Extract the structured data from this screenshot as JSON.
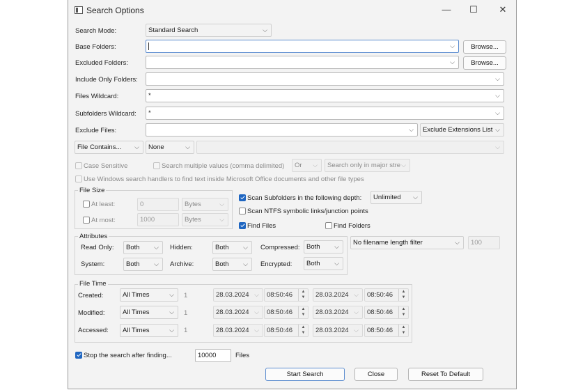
{
  "window": {
    "title": "Search Options",
    "min": "—",
    "max": "☐",
    "close": "✕"
  },
  "search_mode": {
    "label": "Search Mode:",
    "value": "Standard Search"
  },
  "base_folders": {
    "label": "Base Folders:",
    "value": "",
    "browse": "Browse..."
  },
  "excluded_folders": {
    "label": "Excluded Folders:",
    "value": "",
    "browse": "Browse..."
  },
  "include_only": {
    "label": "Include Only Folders:",
    "value": ""
  },
  "files_wildcard": {
    "label": "Files Wildcard:",
    "value": "*"
  },
  "subfolders_wildcard": {
    "label": "Subfolders Wildcard:",
    "value": "*"
  },
  "exclude_files": {
    "label": "Exclude Files:",
    "value": "",
    "ext_list": "Exclude Extensions List"
  },
  "contains": {
    "mode": "File Contains...",
    "type": "None",
    "value": ""
  },
  "options": {
    "case_sensitive": "Case Sensitive",
    "search_multiple": "Search multiple values (comma delimited)",
    "or": "Or",
    "major_streams": "Search only in major stre",
    "windows_handlers": "Use Windows search handlers to find text inside Microsoft Office documents and other file types"
  },
  "file_size": {
    "title": "File Size",
    "at_least": "At least:",
    "at_least_value": "0",
    "at_least_unit": "Bytes",
    "at_most": "At most:",
    "at_most_value": "1000",
    "at_most_unit": "Bytes"
  },
  "scan": {
    "subfolders": "Scan Subfolders in the following depth:",
    "depth": "Unlimited",
    "ntfs": "Scan NTFS symbolic links/junction points",
    "find_files": "Find Files",
    "find_folders": "Find Folders"
  },
  "attributes": {
    "title": "Attributes",
    "read_only": "Read Only:",
    "read_only_value": "Both",
    "hidden": "Hidden:",
    "hidden_value": "Both",
    "compressed": "Compressed:",
    "compressed_value": "Both",
    "system": "System:",
    "system_value": "Both",
    "archive": "Archive:",
    "archive_value": "Both",
    "encrypted": "Encrypted:",
    "encrypted_value": "Both"
  },
  "name_length": {
    "value": "No filename length filter",
    "number": "100"
  },
  "file_time": {
    "title": "File Time",
    "rows": [
      {
        "label": "Created:",
        "mode": "All Times",
        "num": "1",
        "date1": "28.03.2024",
        "time1": "08:50:46",
        "date2": "28.03.2024",
        "time2": "08:50:46"
      },
      {
        "label": "Modified:",
        "mode": "All Times",
        "num": "1",
        "date1": "28.03.2024",
        "time1": "08:50:46",
        "date2": "28.03.2024",
        "time2": "08:50:46"
      },
      {
        "label": "Accessed:",
        "mode": "All Times",
        "num": "1",
        "date1": "28.03.2024",
        "time1": "08:50:46",
        "date2": "28.03.2024",
        "time2": "08:50:46"
      }
    ]
  },
  "stop": {
    "label": "Stop the search after finding...",
    "value": "10000",
    "unit": "Files"
  },
  "buttons": {
    "start": "Start Search",
    "close": "Close",
    "reset": "Reset To Default"
  }
}
